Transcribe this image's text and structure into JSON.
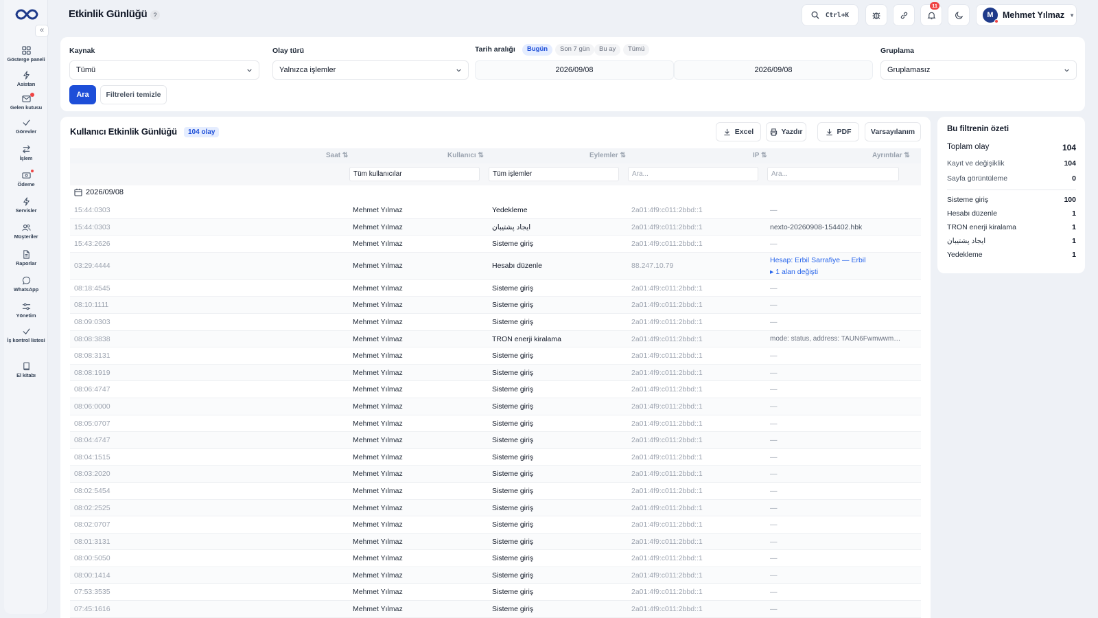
{
  "header": {
    "title": "Etkinlik Günlüğü",
    "help_icon": "?",
    "search_shortcut": "Ctrl+K",
    "notification_count": "11",
    "user_initial": "M",
    "user_name": "Mehmet Yılmaz"
  },
  "sidebar": {
    "collapse": "«",
    "items": [
      {
        "label": "Gösterge paneli",
        "icon": "grid-icon"
      },
      {
        "label": "Asistan",
        "icon": "bolt-icon"
      },
      {
        "label": "Gelen kutusu",
        "icon": "inbox-icon"
      },
      {
        "label": "Görevler",
        "icon": "check-icon"
      },
      {
        "label": "İşlem",
        "icon": "swap-icon"
      },
      {
        "label": "Ödeme",
        "icon": "card-icon"
      },
      {
        "label": "Servisler",
        "icon": "bolt-icon"
      },
      {
        "label": "Müşteriler",
        "icon": "users-icon"
      },
      {
        "label": "Raporlar",
        "icon": "file-icon"
      },
      {
        "label": "WhatsApp",
        "icon": "chat-icon"
      },
      {
        "label": "Yönetim",
        "icon": "sliders-icon"
      },
      {
        "label": "İş kontrol listesi",
        "icon": "check-icon"
      },
      {
        "label": "El kitabı",
        "icon": "book-icon"
      }
    ]
  },
  "filters": {
    "source_label": "Kaynak",
    "source_value": "Tümü",
    "event_type_label": "Olay türü",
    "event_type_value": "Yalnızca işlemler",
    "date_range_label": "Tarih aralığı",
    "date_presets": [
      "Bugün",
      "Son 7 gün",
      "Bu ay",
      "Tümü"
    ],
    "active_preset": "Bugün",
    "date_from": "2026/09/08",
    "date_to": "2026/09/08",
    "grouping_label": "Gruplama",
    "grouping_value": "Gruplamasız",
    "search_button": "Ara",
    "clear_button": "Filtreleri temizle"
  },
  "table": {
    "title": "Kullanıcı Etkinlik Günlüğü",
    "count_badge": "104 olay",
    "toolbar": {
      "excel": "Excel",
      "print": "Yazdır",
      "pdf": "PDF",
      "default": "Varsayılanım"
    },
    "columns": [
      "Saat",
      "Kullanıcı",
      "Eylemler",
      "IP",
      "Ayrıntılar"
    ],
    "sort_icon": "⇅",
    "column_filters": {
      "user": "Tüm kullanıcılar",
      "action": "Tüm işlemler",
      "ip_placeholder": "Ara...",
      "details_placeholder": "Ara..."
    },
    "group_date": "2026/09/08",
    "rows": [
      {
        "time": "15:44:0303",
        "user": "Mehmet Yılmaz",
        "action": "Yedekleme",
        "ip": "2a01:4f9:c011:2bbd::1",
        "details": "—"
      },
      {
        "time": "15:44:0303",
        "user": "Mehmet Yılmaz",
        "action": "ایجاد پشتیبان",
        "ip": "2a01:4f9:c011:2bbd::1",
        "details": "nexto-20260908-154402.hbk"
      },
      {
        "time": "15:43:2626",
        "user": "Mehmet Yılmaz",
        "action": "Sisteme giriş",
        "ip": "2a01:4f9:c011:2bbd::1",
        "details": "—"
      },
      {
        "time": "03:29:4444",
        "user": "Mehmet Yılmaz",
        "action": "Hesabı düzenle",
        "ip": "88.247.10.79",
        "details": "Hesap: Erbil Sarrafiye — Erbil",
        "details2": "▸ 1 alan değişti"
      },
      {
        "time": "08:18:4545",
        "user": "Mehmet Yılmaz",
        "action": "Sisteme giriş",
        "ip": "2a01:4f9:c011:2bbd::1",
        "details": "—"
      },
      {
        "time": "08:10:1111",
        "user": "Mehmet Yılmaz",
        "action": "Sisteme giriş",
        "ip": "2a01:4f9:c011:2bbd::1",
        "details": "—"
      },
      {
        "time": "08:09:0303",
        "user": "Mehmet Yılmaz",
        "action": "Sisteme giriş",
        "ip": "2a01:4f9:c011:2bbd::1",
        "details": "—"
      },
      {
        "time": "08:08:3838",
        "user": "Mehmet Yılmaz",
        "action": "TRON enerji kiralama",
        "ip": "2a01:4f9:c011:2bbd::1",
        "details": "mode: status, address: TAUN6Fwmwwm…"
      },
      {
        "time": "08:08:3131",
        "user": "Mehmet Yılmaz",
        "action": "Sisteme giriş",
        "ip": "2a01:4f9:c011:2bbd::1",
        "details": "—"
      },
      {
        "time": "08:08:1919",
        "user": "Mehmet Yılmaz",
        "action": "Sisteme giriş",
        "ip": "2a01:4f9:c011:2bbd::1",
        "details": "—"
      },
      {
        "time": "08:06:4747",
        "user": "Mehmet Yılmaz",
        "action": "Sisteme giriş",
        "ip": "2a01:4f9:c011:2bbd::1",
        "details": "—"
      },
      {
        "time": "08:06:0000",
        "user": "Mehmet Yılmaz",
        "action": "Sisteme giriş",
        "ip": "2a01:4f9:c011:2bbd::1",
        "details": "—"
      },
      {
        "time": "08:05:0707",
        "user": "Mehmet Yılmaz",
        "action": "Sisteme giriş",
        "ip": "2a01:4f9:c011:2bbd::1",
        "details": "—"
      },
      {
        "time": "08:04:4747",
        "user": "Mehmet Yılmaz",
        "action": "Sisteme giriş",
        "ip": "2a01:4f9:c011:2bbd::1",
        "details": "—"
      },
      {
        "time": "08:04:1515",
        "user": "Mehmet Yılmaz",
        "action": "Sisteme giriş",
        "ip": "2a01:4f9:c011:2bbd::1",
        "details": "—"
      },
      {
        "time": "08:03:2020",
        "user": "Mehmet Yılmaz",
        "action": "Sisteme giriş",
        "ip": "2a01:4f9:c011:2bbd::1",
        "details": "—"
      },
      {
        "time": "08:02:5454",
        "user": "Mehmet Yılmaz",
        "action": "Sisteme giriş",
        "ip": "2a01:4f9:c011:2bbd::1",
        "details": "—"
      },
      {
        "time": "08:02:2525",
        "user": "Mehmet Yılmaz",
        "action": "Sisteme giriş",
        "ip": "2a01:4f9:c011:2bbd::1",
        "details": "—"
      },
      {
        "time": "08:02:0707",
        "user": "Mehmet Yılmaz",
        "action": "Sisteme giriş",
        "ip": "2a01:4f9:c011:2bbd::1",
        "details": "—"
      },
      {
        "time": "08:01:3131",
        "user": "Mehmet Yılmaz",
        "action": "Sisteme giriş",
        "ip": "2a01:4f9:c011:2bbd::1",
        "details": "—"
      },
      {
        "time": "08:00:5050",
        "user": "Mehmet Yılmaz",
        "action": "Sisteme giriş",
        "ip": "2a01:4f9:c011:2bbd::1",
        "details": "—"
      },
      {
        "time": "08:00:1414",
        "user": "Mehmet Yılmaz",
        "action": "Sisteme giriş",
        "ip": "2a01:4f9:c011:2bbd::1",
        "details": "—"
      },
      {
        "time": "07:53:3535",
        "user": "Mehmet Yılmaz",
        "action": "Sisteme giriş",
        "ip": "2a01:4f9:c011:2bbd::1",
        "details": "—"
      },
      {
        "time": "07:45:1616",
        "user": "Mehmet Yılmaz",
        "action": "Sisteme giriş",
        "ip": "2a01:4f9:c011:2bbd::1",
        "details": "—"
      }
    ]
  },
  "summary": {
    "title": "Bu filtrenin özeti",
    "total": {
      "label": "Toplam olay",
      "value": "104"
    },
    "groups": [
      {
        "label": "Kayıt ve değişiklik",
        "value": "104"
      },
      {
        "label": "Sayfa görüntüleme",
        "value": "0"
      }
    ],
    "items": [
      {
        "label": "Sisteme giriş",
        "value": "100"
      },
      {
        "label": "Hesabı düzenle",
        "value": "1"
      },
      {
        "label": "TRON enerji kiralama",
        "value": "1"
      },
      {
        "label": "ایجاد پشتیبان",
        "value": "1"
      },
      {
        "label": "Yedekleme",
        "value": "1"
      }
    ]
  },
  "colors": {
    "accent": "#1d4ed8",
    "danger": "#ef4444",
    "background": "#eef1f6"
  }
}
